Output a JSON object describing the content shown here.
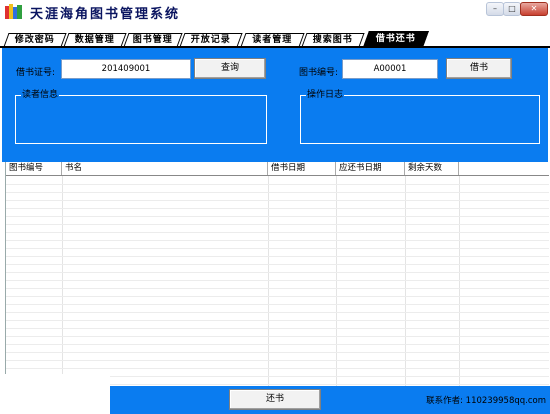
{
  "window": {
    "title": "天涯海角图书管理系统",
    "min_label": "–",
    "max_label": "□",
    "close_label": "✕"
  },
  "tabs": [
    {
      "label": "修改密码",
      "active": false
    },
    {
      "label": "数据管理",
      "active": false
    },
    {
      "label": "图书管理",
      "active": false
    },
    {
      "label": "开放记录",
      "active": false
    },
    {
      "label": "读者管理",
      "active": false
    },
    {
      "label": "搜索图书",
      "active": false
    },
    {
      "label": "借书还书",
      "active": true
    }
  ],
  "borrow_panel": {
    "card_label": "借书证号:",
    "card_value": "201409001",
    "query_button": "查询",
    "book_label": "图书编号:",
    "book_value": "A00001",
    "borrow_button": "借书",
    "reader_group_title": "读者信息",
    "log_group_title": "操作日志"
  },
  "table": {
    "columns": [
      "图书编号",
      "书名",
      "借书日期",
      "应还书日期",
      "剩余天数"
    ],
    "rows": []
  },
  "footer": {
    "return_button": "还书",
    "credit": "联系作者: 110239958qq.com"
  },
  "colors": {
    "panel_blue": "#0a7cf0",
    "tab_active": "#000000"
  }
}
